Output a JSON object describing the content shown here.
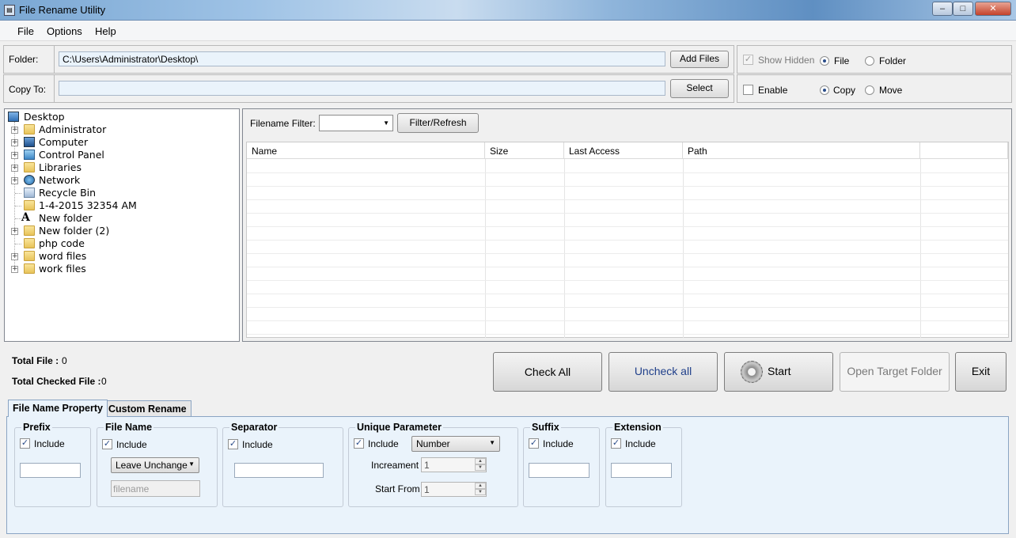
{
  "window": {
    "title": "File Rename Utility",
    "icon": "app-icon",
    "controls": {
      "minimize": "‒",
      "maximize": "□",
      "close": "✕"
    }
  },
  "menu": [
    "File",
    "Options",
    "Help"
  ],
  "folder": {
    "label": "Folder:",
    "value": "C:\\Users\\Administrator\\Desktop\\",
    "add_files": "Add Files",
    "show_hidden": "Show Hidden",
    "file": "File",
    "folder_opt": "Folder"
  },
  "copy_to": {
    "label": "Copy To:",
    "value": "",
    "select": "Select",
    "enable": "Enable",
    "copy": "Copy",
    "move": "Move"
  },
  "tree": {
    "items": [
      {
        "label": "Desktop",
        "icon": "desktop-icon",
        "expander": false,
        "level": 0
      },
      {
        "label": "Administrator",
        "icon": "user-folder-icon",
        "expander": true,
        "level": 1
      },
      {
        "label": "Computer",
        "icon": "computer-icon",
        "expander": true,
        "level": 1
      },
      {
        "label": "Control Panel",
        "icon": "control-panel-icon",
        "expander": true,
        "level": 1
      },
      {
        "label": "Libraries",
        "icon": "libraries-icon",
        "expander": true,
        "level": 1
      },
      {
        "label": "Network",
        "icon": "network-icon",
        "expander": true,
        "level": 1
      },
      {
        "label": "Recycle Bin",
        "icon": "recycle-bin-icon",
        "expander": false,
        "level": 1
      },
      {
        "label": "1-4-2015 32354 AM",
        "icon": "folder-icon",
        "expander": false,
        "level": 1
      },
      {
        "label": "New folder",
        "icon": "font-icon",
        "expander": false,
        "level": 1
      },
      {
        "label": "New folder (2)",
        "icon": "folder-icon",
        "expander": true,
        "level": 1
      },
      {
        "label": "php code",
        "icon": "folder-icon",
        "expander": false,
        "level": 1
      },
      {
        "label": "word files",
        "icon": "folder-icon",
        "expander": true,
        "level": 1
      },
      {
        "label": "work files",
        "icon": "folder-icon",
        "expander": true,
        "level": 1
      }
    ]
  },
  "filter": {
    "label": "Filename Filter:",
    "value": "",
    "button": "Filter/Refresh"
  },
  "grid": {
    "columns": [
      "Name",
      "Size",
      "Last Access",
      "Path"
    ],
    "rows": []
  },
  "totals": {
    "total_file_label": "Total File :",
    "total_file_value": "0",
    "total_checked_label": "Total Checked File :",
    "total_checked_value": "0"
  },
  "actions": {
    "check_all": "Check All",
    "uncheck_all": "Uncheck all",
    "start": "Start",
    "open_target": "Open Target Folder",
    "exit": "Exit"
  },
  "tabs": [
    "File Name Property",
    "Custom Rename"
  ],
  "groups": {
    "prefix": {
      "title": "Prefix",
      "include": "Include",
      "value": ""
    },
    "filename": {
      "title": "File Name",
      "include": "Include",
      "mode": "Leave Unchange",
      "placeholder": "filename"
    },
    "separator": {
      "title": "Separator",
      "include": "Include",
      "value": ""
    },
    "unique": {
      "title": "Unique Parameter",
      "include": "Include",
      "type": "Number",
      "increament_label": "Increament",
      "increament_value": "1",
      "start_label": "Start From",
      "start_value": "1"
    },
    "suffix": {
      "title": "Suffix",
      "include": "Include",
      "value": ""
    },
    "extension": {
      "title": "Extension",
      "include": "Include",
      "value": ""
    }
  },
  "colors": {
    "accent": "#2a4d8a",
    "panel": "#eaf3fb",
    "uncheck_text": "#1f3f8a"
  }
}
